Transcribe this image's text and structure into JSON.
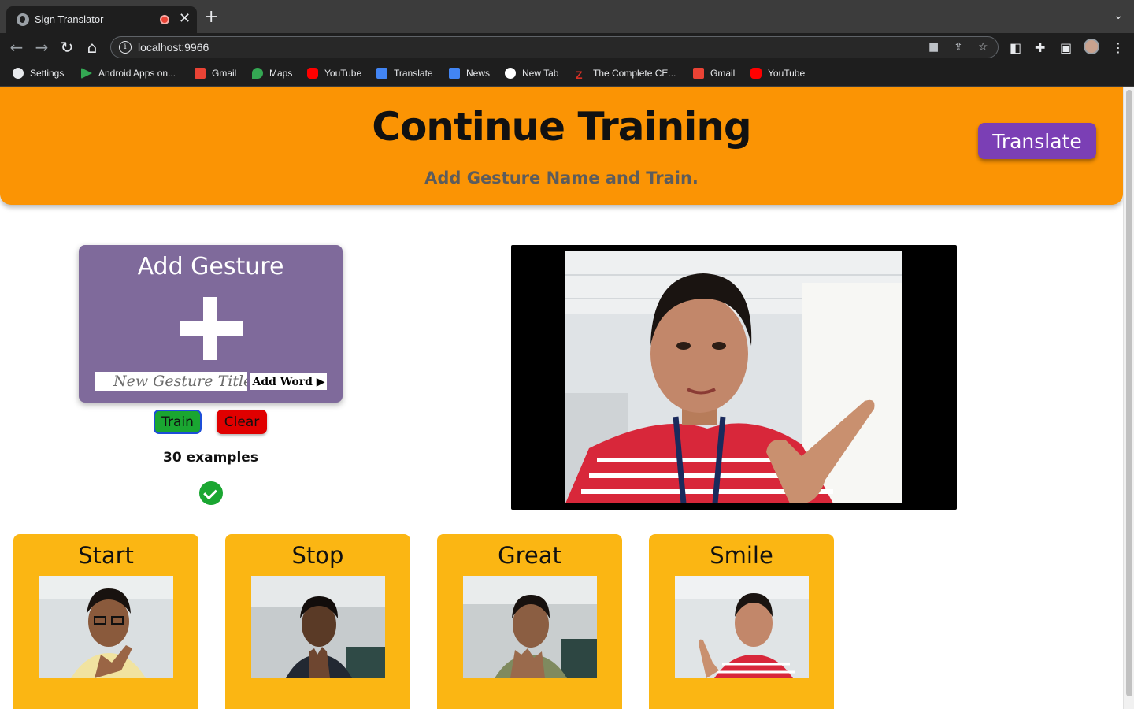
{
  "browser": {
    "tab_title": "Sign Translator",
    "tab_close": "✕",
    "new_tab": "+",
    "tab_menu": "⌄",
    "url": "localhost:9966",
    "bookmarks": [
      {
        "label": "Settings",
        "icon": "gear-icon",
        "color": "#e8eaed"
      },
      {
        "label": "Android Apps on...",
        "icon": "play-store-icon",
        "color": "#34a853"
      },
      {
        "label": "Gmail",
        "icon": "gmail-icon",
        "color": "#ea4335"
      },
      {
        "label": "Maps",
        "icon": "maps-icon",
        "color": "#34a853"
      },
      {
        "label": "YouTube",
        "icon": "youtube-icon",
        "color": "#ff0000"
      },
      {
        "label": "Translate",
        "icon": "translate-icon",
        "color": "#4285f4"
      },
      {
        "label": "News",
        "icon": "news-icon",
        "color": "#4285f4"
      },
      {
        "label": "New Tab",
        "icon": "new-tab-icon",
        "color": "#ffffff"
      },
      {
        "label": "The Complete CE...",
        "icon": "z-icon",
        "color": "#d93025"
      },
      {
        "label": "Gmail",
        "icon": "gmail-icon",
        "color": "#ea4335"
      },
      {
        "label": "YouTube",
        "icon": "youtube-icon",
        "color": "#ff0000"
      }
    ]
  },
  "header": {
    "title": "Continue Training",
    "subtitle": "Add Gesture Name and Train.",
    "translate_label": "Translate",
    "bg_color": "#fb9404",
    "button_color": "#7b3fb5"
  },
  "add_gesture": {
    "title": "Add Gesture",
    "input_placeholder": "New Gesture Title",
    "add_word_label": "Add Word ▶",
    "card_color": "#7f6a9b"
  },
  "controls": {
    "train_label": "Train",
    "clear_label": "Clear",
    "examples_text": "30 examples"
  },
  "gestures": [
    {
      "name": "Start"
    },
    {
      "name": "Stop"
    },
    {
      "name": "Great"
    },
    {
      "name": "Smile"
    }
  ],
  "colors": {
    "gesture_card": "#fbb613",
    "train_green": "#1aa631",
    "clear_red": "#e00000"
  }
}
